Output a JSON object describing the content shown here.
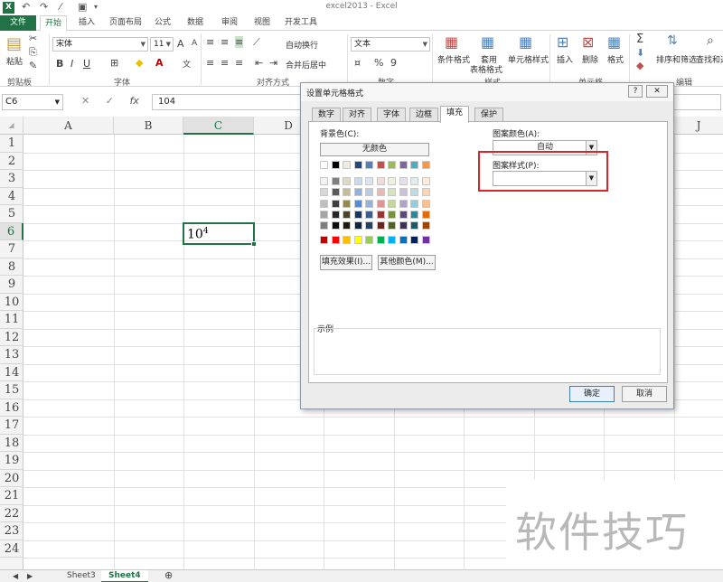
{
  "window": {
    "title": "excel2013 - Excel",
    "app_icon": "X"
  },
  "ribbon_tabs": [
    "文件",
    "开始",
    "插入",
    "页面布局",
    "公式",
    "数据",
    "审阅",
    "视图",
    "开发工具"
  ],
  "ribbon": {
    "clipboard": {
      "paste": "粘贴",
      "group": "剪贴板"
    },
    "font": {
      "name": "宋体",
      "size": "11",
      "grow": "A",
      "shrink": "A",
      "bold": "B",
      "italic": "I",
      "underline": "U",
      "wen": "文",
      "group": "字体"
    },
    "alignment": {
      "wrap": "自动换行",
      "merge": "合并后居中",
      "group": "对齐方式"
    },
    "number": {
      "format": "文本",
      "percent": "%",
      "comma": "9",
      "group": "数字"
    },
    "styles": {
      "conditional": "条件格式",
      "table1": "套用",
      "table2": "表格格式",
      "cell": "单元格样式",
      "group": "样式"
    },
    "cells": {
      "insert": "插入",
      "delete": "删除",
      "format": "格式",
      "group": "单元格"
    },
    "editing": {
      "sort": "排序和筛选",
      "find": "查找和选",
      "group": "编辑"
    }
  },
  "formula_bar": {
    "name_box": "C6",
    "cancel": "✕",
    "enter": "✓",
    "fx": "fx",
    "content": "104"
  },
  "grid": {
    "columns": [
      "A",
      "B",
      "C",
      "D",
      "J"
    ],
    "rows": [
      "1",
      "2",
      "3",
      "4",
      "5",
      "6",
      "7",
      "8",
      "9",
      "10",
      "11",
      "12",
      "13",
      "14",
      "15",
      "16",
      "17",
      "18",
      "19",
      "20",
      "21",
      "22",
      "23",
      "24"
    ],
    "active_cell": {
      "base": "10",
      "exponent": "4"
    }
  },
  "sheets": [
    "Sheet3",
    "Sheet4"
  ],
  "sheet_add": "⊕",
  "watermark": "软件技巧",
  "dialog": {
    "title": "设置单元格格式",
    "help": "?",
    "close": "✕",
    "tabs": [
      "数字",
      "对齐",
      "字体",
      "边框",
      "填充",
      "保护"
    ],
    "bg_label": "背景色(C):",
    "no_color": "无颜色",
    "fill_effects": "填充效果(I)...",
    "more_colors": "其他颜色(M)...",
    "pattern_color_label": "图案颜色(A):",
    "pattern_color_value": "自动",
    "pattern_style_label": "图案样式(P):",
    "pattern_style_value": "",
    "sample_label": "示例",
    "ok": "确定",
    "cancel": "取消",
    "palette": {
      "theme_top": [
        "#ffffff",
        "#000000",
        "#eeece1",
        "#1f497d",
        "#4f81bd",
        "#c0504d",
        "#9bbb59",
        "#8064a2",
        "#4bacc6",
        "#f79646"
      ],
      "theme_shades": [
        [
          "#f2f2f2",
          "#7f7f7f",
          "#ddd9c3",
          "#c6d9f0",
          "#dbe5f1",
          "#f2dcdb",
          "#ebf1dd",
          "#e5e0ec",
          "#dbeef3",
          "#fdeada"
        ],
        [
          "#d8d8d8",
          "#595959",
          "#c4bd97",
          "#8db3e2",
          "#b8cce4",
          "#e5b9b7",
          "#d7e3bc",
          "#ccc1d9",
          "#b7dde8",
          "#fbd5b5"
        ],
        [
          "#bfbfbf",
          "#3f3f3f",
          "#938953",
          "#548dd4",
          "#95b3d7",
          "#d99694",
          "#c3d69b",
          "#b2a2c7",
          "#92cddc",
          "#fac08f"
        ],
        [
          "#a5a5a5",
          "#262626",
          "#494429",
          "#17365d",
          "#366092",
          "#953734",
          "#76923c",
          "#5f497a",
          "#31859b",
          "#e36c09"
        ],
        [
          "#7f7f7f",
          "#0c0c0c",
          "#1d1b10",
          "#0f243e",
          "#244061",
          "#632423",
          "#4f6128",
          "#3f3151",
          "#205867",
          "#974806"
        ]
      ],
      "standard": [
        "#c00000",
        "#ff0000",
        "#ffc000",
        "#ffff00",
        "#92d050",
        "#00b050",
        "#00b0f0",
        "#0070c0",
        "#002060",
        "#7030a0"
      ]
    }
  },
  "colors": {
    "excel_green": "#217346",
    "highlight_red": "#d9262b"
  }
}
